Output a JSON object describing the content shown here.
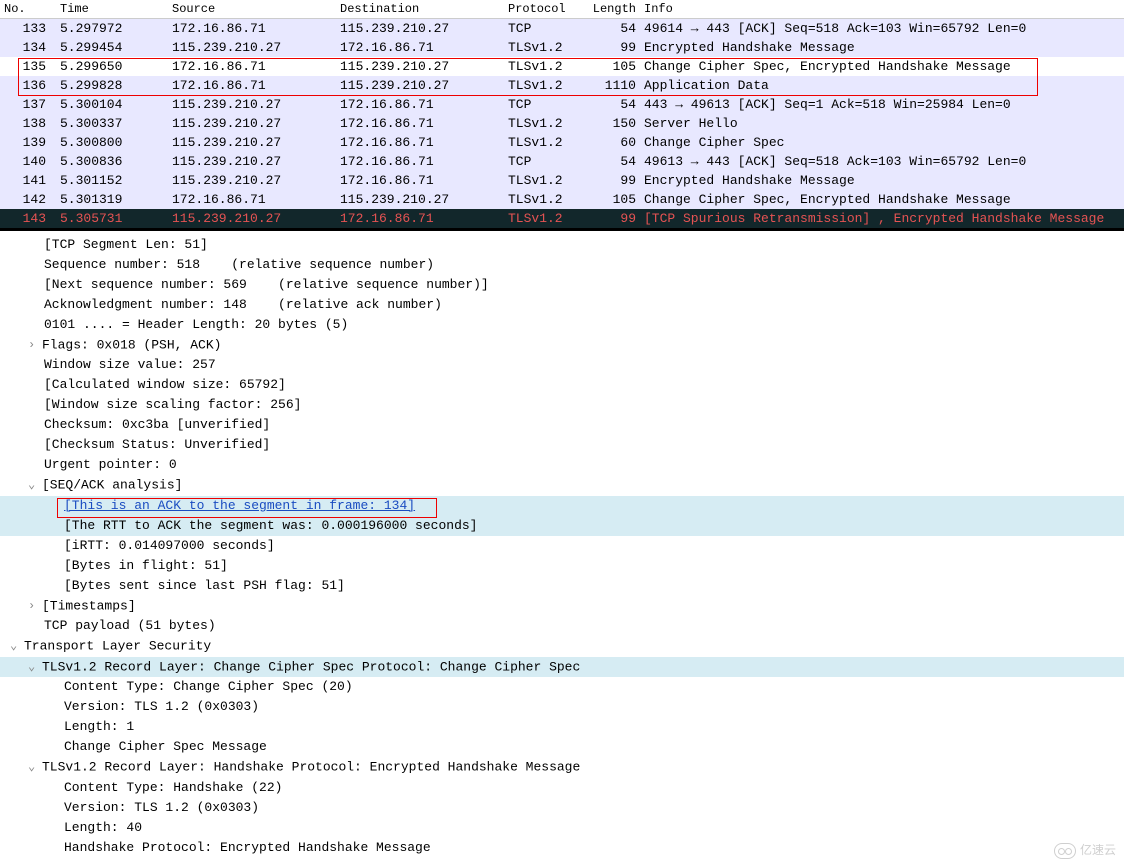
{
  "columns": {
    "no": "No.",
    "time": "Time",
    "source": "Source",
    "destination": "Destination",
    "protocol": "Protocol",
    "length": "Length",
    "info": "Info"
  },
  "packets": [
    {
      "no": "133",
      "time": "5.297972",
      "src": "172.16.86.71",
      "dst": "115.239.210.27",
      "proto": "TCP",
      "len": "54",
      "info": "49614 → 443 [ACK] Seq=518 Ack=103 Win=65792 Len=0",
      "cls": "lavender"
    },
    {
      "no": "134",
      "time": "5.299454",
      "src": "115.239.210.27",
      "dst": "172.16.86.71",
      "proto": "TLSv1.2",
      "len": "99",
      "info": "Encrypted Handshake Message",
      "cls": "lavender"
    },
    {
      "no": "135",
      "time": "5.299650",
      "src": "172.16.86.71",
      "dst": "115.239.210.27",
      "proto": "TLSv1.2",
      "len": "105",
      "info": "Change Cipher Spec, Encrypted Handshake Message",
      "cls": "alt"
    },
    {
      "no": "136",
      "time": "5.299828",
      "src": "172.16.86.71",
      "dst": "115.239.210.27",
      "proto": "TLSv1.2",
      "len": "1110",
      "info": "Application Data",
      "cls": "lavender"
    },
    {
      "no": "137",
      "time": "5.300104",
      "src": "115.239.210.27",
      "dst": "172.16.86.71",
      "proto": "TCP",
      "len": "54",
      "info": "443 → 49613 [ACK] Seq=1 Ack=518 Win=25984 Len=0",
      "cls": "lavender"
    },
    {
      "no": "138",
      "time": "5.300337",
      "src": "115.239.210.27",
      "dst": "172.16.86.71",
      "proto": "TLSv1.2",
      "len": "150",
      "info": "Server Hello",
      "cls": "lavender"
    },
    {
      "no": "139",
      "time": "5.300800",
      "src": "115.239.210.27",
      "dst": "172.16.86.71",
      "proto": "TLSv1.2",
      "len": "60",
      "info": "Change Cipher Spec",
      "cls": "lavender"
    },
    {
      "no": "140",
      "time": "5.300836",
      "src": "115.239.210.27",
      "dst": "172.16.86.71",
      "proto": "TCP",
      "len": "54",
      "info": "49613 → 443 [ACK] Seq=518 Ack=103 Win=65792 Len=0",
      "cls": "lavender"
    },
    {
      "no": "141",
      "time": "5.301152",
      "src": "115.239.210.27",
      "dst": "172.16.86.71",
      "proto": "TLSv1.2",
      "len": "99",
      "info": "Encrypted Handshake Message",
      "cls": "lavender"
    },
    {
      "no": "142",
      "time": "5.301319",
      "src": "172.16.86.71",
      "dst": "115.239.210.27",
      "proto": "TLSv1.2",
      "len": "105",
      "info": "Change Cipher Spec, Encrypted Handshake Message",
      "cls": "lavender"
    },
    {
      "no": "143",
      "time": "5.305731",
      "src": "115.239.210.27",
      "dst": "172.16.86.71",
      "proto": "TLSv1.2",
      "len": "99",
      "info": "[TCP Spurious Retransmission] , Encrypted Handshake Message",
      "cls": "error"
    }
  ],
  "details": {
    "tcp_seg_len": "[TCP Segment Len: 51]",
    "seq_num": "Sequence number: 518    (relative sequence number)",
    "next_seq": "[Next sequence number: 569    (relative sequence number)]",
    "ack_num": "Acknowledgment number: 148    (relative ack number)",
    "hdr_len": "0101 .... = Header Length: 20 bytes (5)",
    "flags": "Flags: 0x018 (PSH, ACK)",
    "win_size": "Window size value: 257",
    "calc_win": "[Calculated window size: 65792]",
    "win_scale": "[Window size scaling factor: 256]",
    "checksum": "Checksum: 0xc3ba [unverified]",
    "chk_status": "[Checksum Status: Unverified]",
    "urgent": "Urgent pointer: 0",
    "seqack": "[SEQ/ACK analysis]",
    "ack_to": "[This is an ACK to the segment in frame: 134]",
    "rtt": "[The RTT to ACK the segment was: 0.000196000 seconds]",
    "irtt": "[iRTT: 0.014097000 seconds]",
    "bif": "[Bytes in flight: 51]",
    "bytes_psh": "[Bytes sent since last PSH flag: 51]",
    "timestamps": "[Timestamps]",
    "payload": "TCP payload (51 bytes)",
    "tls_header": "Transport Layer Security",
    "tls_rec1": "TLSv1.2 Record Layer: Change Cipher Spec Protocol: Change Cipher Spec",
    "ct1": "Content Type: Change Cipher Spec (20)",
    "ver1": "Version: TLS 1.2 (0x0303)",
    "len1": "Length: 1",
    "ccs_msg": "Change Cipher Spec Message",
    "tls_rec2": "TLSv1.2 Record Layer: Handshake Protocol: Encrypted Handshake Message",
    "ct2": "Content Type: Handshake (22)",
    "ver2": "Version: TLS 1.2 (0x0303)",
    "len2": "Length: 40",
    "hs_proto": "Handshake Protocol: Encrypted Handshake Message"
  },
  "watermark": "亿速云"
}
